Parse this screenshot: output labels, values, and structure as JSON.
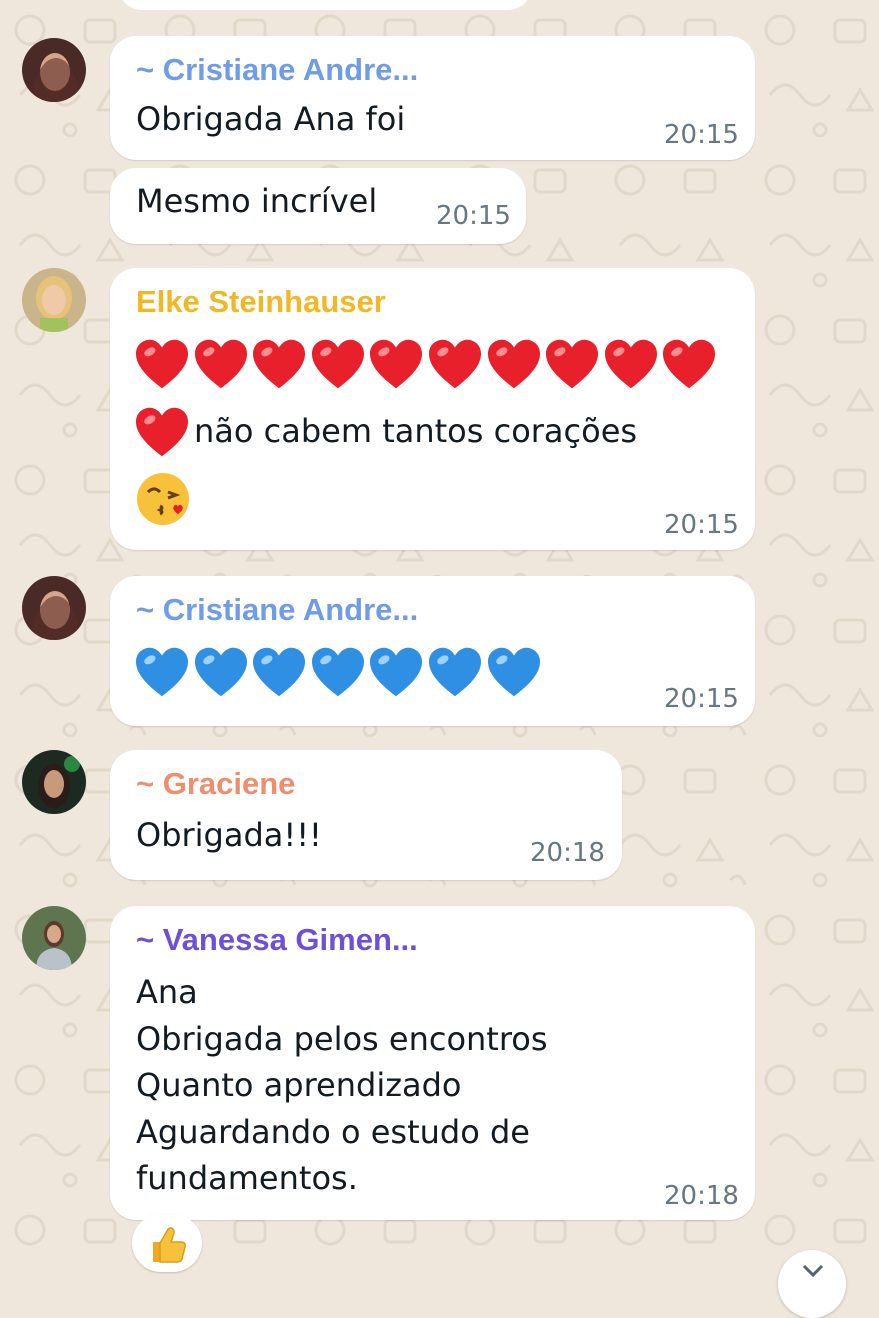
{
  "colors": {
    "wallpaper": "#efe7dc",
    "bubble": "#ffffff",
    "timestamp": "#667781",
    "red_heart": "#e8202c",
    "blue_heart": "#2f8fe3"
  },
  "messages": [
    {
      "sender": "~ Cristiane Andre...",
      "sender_color": "#6f9ce8",
      "text": "Obrigada Ana foi",
      "time": "20:15"
    },
    {
      "text": "Mesmo incrível",
      "time": "20:15"
    },
    {
      "sender": "Elke Steinhauser",
      "sender_color": "#f2b824",
      "red_hearts": 11,
      "text": "não cabem tantos corações",
      "time": "20:15"
    },
    {
      "sender": "~ Cristiane Andre...",
      "sender_color": "#6f9ce8",
      "blue_hearts": 7,
      "time": "20:15"
    },
    {
      "sender": "~ Graciene",
      "sender_color": "#ee8e6e",
      "text": "Obrigada!!!",
      "time": "20:18"
    },
    {
      "sender": "~ Vanessa Gimen...",
      "sender_color": "#6f4fd7",
      "lines": [
        "Ana",
        "Obrigada pelos encontros",
        "Quanto aprendizado",
        "Aguardando o estudo de",
        "fundamentos."
      ],
      "time": "20:18",
      "reaction": "thumbs-up"
    }
  ]
}
